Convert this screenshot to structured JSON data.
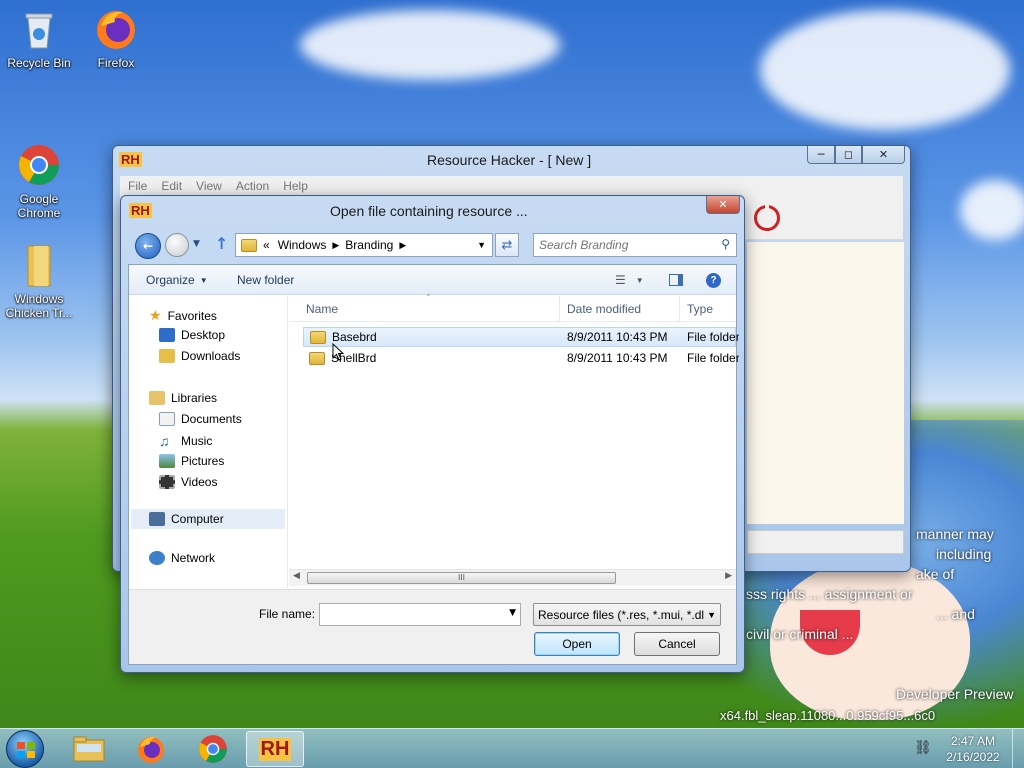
{
  "desktop": {
    "icons": [
      {
        "label": "Recycle Bin"
      },
      {
        "label": "Firefox"
      },
      {
        "label": "Google\nChrome"
      },
      {
        "label": "Windows\nChicken Tr..."
      }
    ],
    "watermark": {
      "line1": "manner may",
      "line2": "including",
      "line3": "ake of",
      "line4": "sss rights ... assignment or",
      "line5": "... and",
      "line6": "civil or criminal ...",
      "line7": "Developer Preview",
      "line8": "x64.fbl_sleap.11080...0.959cf95...6c0"
    }
  },
  "rh_window": {
    "title": "Resource Hacker - [ New ]",
    "menu": [
      "File",
      "Edit",
      "View",
      "Action",
      "Help"
    ],
    "logo": "RH"
  },
  "dialog": {
    "title": "Open file containing resource ...",
    "logo": "RH",
    "breadcrumb": [
      "Windows",
      "Branding"
    ],
    "breadcrumb_prefix": "«",
    "search_placeholder": "Search Branding",
    "toolbar": {
      "organize": "Organize",
      "new_folder": "New folder"
    },
    "nav": {
      "favorites": "Favorites",
      "desktop": "Desktop",
      "downloads": "Downloads",
      "libraries": "Libraries",
      "documents": "Documents",
      "music": "Music",
      "pictures": "Pictures",
      "videos": "Videos",
      "computer": "Computer",
      "network": "Network"
    },
    "columns": {
      "name": "Name",
      "date": "Date modified",
      "type": "Type"
    },
    "files": [
      {
        "name": "Basebrd",
        "date": "8/9/2011 10:43 PM",
        "type": "File folder"
      },
      {
        "name": "ShellBrd",
        "date": "8/9/2011 10:43 PM",
        "type": "File folder"
      }
    ],
    "filename_label": "File name:",
    "filename_value": "",
    "filter": "Resource files (*.res, *.mui, *.dll",
    "open_label": "Open",
    "cancel_label": "Cancel",
    "scroll_grip": "III"
  },
  "taskbar": {
    "clock_time": "2:47 AM",
    "clock_date": "2/16/2022",
    "rh_label": "RH"
  },
  "colors": {
    "accent": "#3b7bd8",
    "selected_row": "#cce4f7",
    "power_red": "#d02020"
  }
}
